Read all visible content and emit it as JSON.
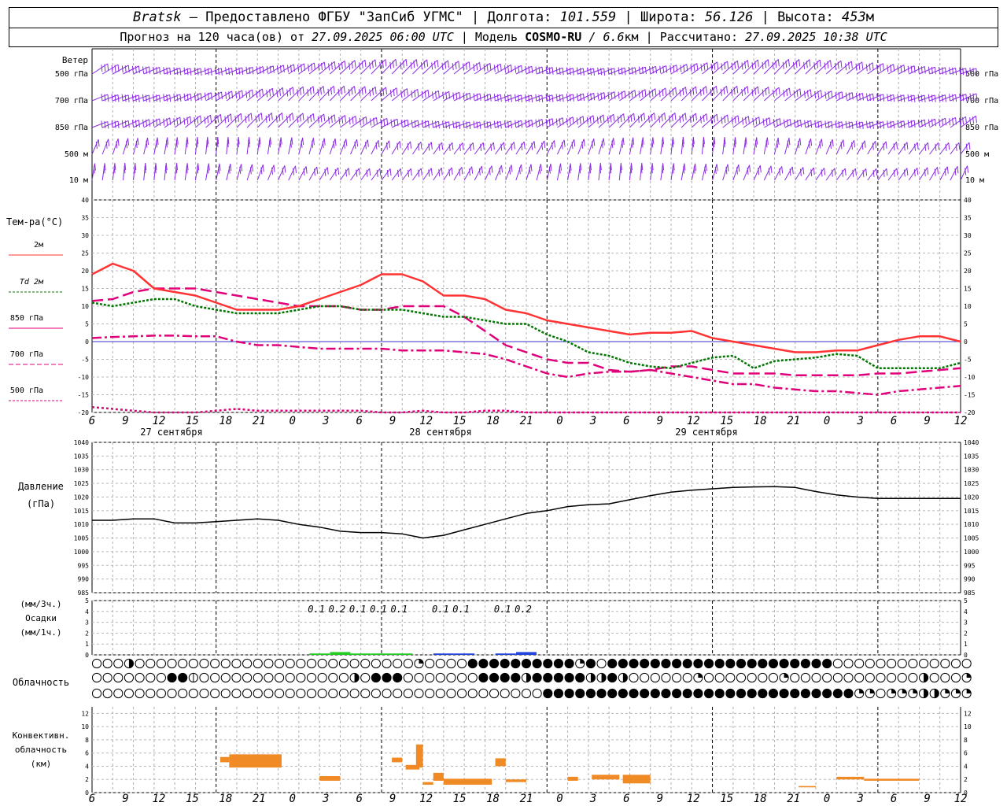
{
  "header": {
    "station": "Bratsk",
    "dash": "—",
    "provider": "Предоставлено ФГБУ \"ЗапСиб УГМС\"",
    "lon_label": "Долгота:",
    "lon_value": "101.559",
    "lat_label": "Широта:",
    "lat_value": "56.126",
    "alt_label": "Высота:",
    "alt_value": "453",
    "alt_unit": "м",
    "sep": "|",
    "forecast_prefix": "Прогноз на 120 часа(ов) от",
    "forecast_base": "27.09.2025 06:00 UTC",
    "model_label": "Модель",
    "model_name": "COSMO-RU",
    "model_res_slash": "/",
    "model_res": "6.6",
    "model_res_unit": "км",
    "calc_label": "Рассчитано:",
    "calc_time": "27.09.2025 10:38 UTC"
  },
  "wind_panel": {
    "title": "Ветер",
    "levels": [
      "500 гПа",
      "700 гПа",
      "850 гПа",
      "500 м",
      "10 м"
    ]
  },
  "temp_panel": {
    "title": "Тем-ра(°С)",
    "legend": [
      "2м",
      "Td 2м",
      "850 гПа",
      "700 гПа",
      "500 гПа"
    ],
    "yticks": [
      40,
      35,
      30,
      25,
      20,
      15,
      10,
      5,
      0,
      -5,
      -10,
      -15,
      -20
    ]
  },
  "pressure_panel": {
    "title": "Давление",
    "unit": "(гПа)",
    "yticks": [
      1040,
      1035,
      1030,
      1025,
      1020,
      1015,
      1010,
      1005,
      1000,
      995,
      990,
      985
    ]
  },
  "precip_panel": {
    "unit3": "(мм/3ч.)",
    "title": "Осадки",
    "unit1": "(мм/1ч.)",
    "yticks": [
      5,
      4,
      3,
      2,
      1,
      0
    ],
    "labels": [
      "0.1",
      "0.2",
      "0.1",
      "0.1",
      "0.1",
      "0.1",
      "0.1",
      "0.1",
      "0.2"
    ]
  },
  "cloud_panel": {
    "title": "Облачность"
  },
  "conv_panel": {
    "title_lines": [
      "Конвективн.",
      "облачность",
      "(км)"
    ],
    "yticks": [
      12,
      10,
      8,
      6,
      4,
      2,
      0
    ]
  },
  "axis": {
    "hour_labels": [
      "6",
      "9",
      "12",
      "15",
      "18",
      "21",
      "0",
      "3",
      "6",
      "9",
      "12",
      "15",
      "18",
      "21",
      "0",
      "3",
      "6",
      "9",
      "12",
      "15",
      "18",
      "21",
      "0",
      "3",
      "6",
      "9",
      "12"
    ],
    "day_labels": [
      "27 сентября",
      "28 сентября",
      "29 сентября"
    ]
  },
  "colors": {
    "t2m": "#ff3333",
    "td2m": "#007700",
    "t850": "#e0007a",
    "wind": "#8a2be2",
    "conv": "#f08a24",
    "pressure": "#000000"
  },
  "chart_data": {
    "type": "line",
    "x_hours_from_start": [
      0,
      3,
      6,
      9,
      12,
      15,
      18,
      21,
      24,
      27,
      30,
      33,
      36,
      39,
      42,
      45,
      48,
      51,
      54,
      57,
      60,
      63,
      66,
      69,
      72,
      75,
      78,
      81,
      84,
      87,
      90,
      93,
      96,
      99,
      102,
      105,
      108,
      111,
      114,
      117,
      120,
      123,
      126
    ],
    "series": [
      {
        "name": "2м",
        "values": [
          19,
          22,
          20,
          15,
          14,
          13,
          11,
          9,
          9,
          9,
          10,
          12,
          14,
          16,
          19,
          19,
          17,
          13,
          13,
          12,
          9,
          8,
          6,
          5,
          4,
          3,
          2,
          2.5,
          2.5,
          3,
          1,
          0,
          -1,
          -2,
          -3,
          -3,
          -2.5,
          -2.5,
          -1,
          0.5,
          1.5,
          1.5,
          0
        ]
      },
      {
        "name": "Td 2м",
        "values": [
          11,
          10,
          11,
          12,
          12,
          10,
          9,
          8,
          8,
          8,
          9,
          10,
          10,
          9,
          9,
          9,
          8,
          7,
          7,
          6,
          5,
          5,
          2,
          0,
          -3,
          -4,
          -6,
          -7,
          -7.5,
          -6,
          -4.5,
          -4,
          -7.5,
          -5.5,
          -5,
          -4.5,
          -3.5,
          -4,
          -7.5,
          -7.5,
          -7.5,
          -7.5,
          -6
        ]
      },
      {
        "name": "850 гПа",
        "values": [
          11.5,
          12,
          14,
          15,
          15,
          15,
          14,
          13,
          12,
          11,
          10,
          10,
          10,
          9,
          9,
          10,
          10,
          10,
          7,
          3,
          -1,
          -3,
          -5,
          -6,
          -6,
          -8,
          -8.5,
          -8,
          -7,
          -7,
          -8,
          -9,
          -9,
          -9,
          -9.5,
          -9.5,
          -9.5,
          -9.5,
          -9,
          -9,
          -8.5,
          -8,
          -7.5
        ]
      },
      {
        "name": "700 гПа",
        "values": [
          1,
          1.3,
          1.5,
          1.7,
          1.7,
          1.5,
          1.5,
          0,
          -1,
          -1,
          -1.5,
          -2,
          -2,
          -2,
          -2,
          -2.5,
          -2.5,
          -2.5,
          -3,
          -3.5,
          -5,
          -7,
          -9,
          -10,
          -9,
          -8.5,
          -8.5,
          -8,
          -9,
          -10,
          -11,
          -12,
          -12,
          -13,
          -13.5,
          -14,
          -14,
          -14.5,
          -15,
          -14,
          -13.5,
          -13,
          -12.5
        ]
      },
      {
        "name": "500 гПа",
        "values": [
          -18.5,
          -19,
          -19.5,
          -20,
          -20.5,
          -20.5,
          -19.5,
          -19,
          -19.5,
          -19.5,
          -19.5,
          -19.5,
          -19.5,
          -19.5,
          -20,
          -20,
          -19.5,
          -20,
          -20,
          -19.5,
          -19.5,
          -20,
          -20.5,
          -21,
          -21,
          -21,
          -21,
          -21,
          -21,
          -21,
          -21,
          -21,
          -21,
          -21,
          -21,
          -21,
          -21,
          -21,
          -21,
          -21,
          -21,
          -21,
          -21
        ]
      },
      {
        "name": "Давление",
        "values": [
          1011.5,
          1011.5,
          1012,
          1012,
          1010.5,
          1010.5,
          1011,
          1011.5,
          1012,
          1011.5,
          1010,
          1009,
          1007.5,
          1007,
          1007,
          1006.5,
          1005,
          1006,
          1008,
          1010,
          1012,
          1014,
          1015,
          1016.5,
          1017.2,
          1017.5,
          1019,
          1020.5,
          1021.8,
          1022.5,
          1023,
          1023.5,
          1023.7,
          1023.8,
          1023.5,
          1022,
          1020.8,
          1020,
          1019.5,
          1019.5,
          1019.5,
          1019.5,
          1019.5
        ]
      }
    ],
    "precip_3h": [
      {
        "hour": 33,
        "value": 0.1
      },
      {
        "hour": 36,
        "value": 0.2
      },
      {
        "hour": 39,
        "value": 0.1
      },
      {
        "hour": 42,
        "value": 0.1
      },
      {
        "hour": 45,
        "value": 0.1
      },
      {
        "hour": 51,
        "value": 0.1
      },
      {
        "hour": 54,
        "value": 0.1
      },
      {
        "hour": 60,
        "value": 0.1
      },
      {
        "hour": 63,
        "value": 0.2
      }
    ],
    "xlabel": "",
    "ylim_temp": [
      -20,
      40
    ],
    "ylim_pressure": [
      985,
      1040
    ],
    "ylim_precip": [
      0,
      5
    ],
    "ylim_conv": [
      0,
      13
    ],
    "grid": true
  }
}
